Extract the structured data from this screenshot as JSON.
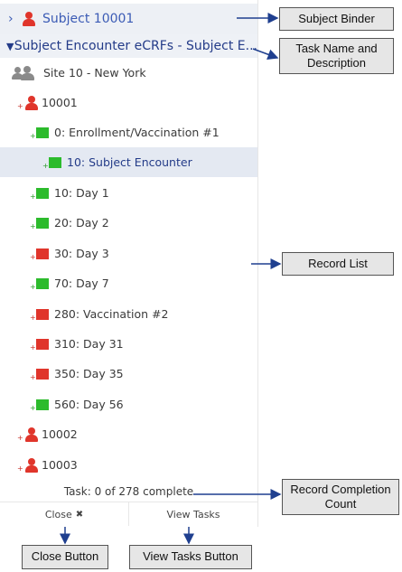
{
  "binder": {
    "label": "Subject 10001"
  },
  "task": {
    "label": "Subject Encounter eCRFs - Subject E..."
  },
  "site": {
    "label": "Site 10 - New York"
  },
  "records": [
    {
      "label": "10001",
      "type": "subject",
      "status": "red"
    },
    {
      "label": "0: Enrollment/Vaccination #1",
      "type": "form",
      "status": "green"
    },
    {
      "label": "10: Subject Encounter",
      "type": "form",
      "status": "green",
      "selected": true
    },
    {
      "label": "10: Day 1",
      "type": "form",
      "status": "green"
    },
    {
      "label": "20: Day 2",
      "type": "form",
      "status": "green"
    },
    {
      "label": "30: Day 3",
      "type": "form",
      "status": "red"
    },
    {
      "label": "70: Day 7",
      "type": "form",
      "status": "green"
    },
    {
      "label": "280: Vaccination #2",
      "type": "form",
      "status": "red"
    },
    {
      "label": "310: Day 31",
      "type": "form",
      "status": "red"
    },
    {
      "label": "350: Day 35",
      "type": "form",
      "status": "red"
    },
    {
      "label": "560: Day 56",
      "type": "form",
      "status": "green"
    },
    {
      "label": "10002",
      "type": "subject",
      "status": "red"
    },
    {
      "label": "10003",
      "type": "subject",
      "status": "red"
    }
  ],
  "footer": {
    "count": "Task: 0 of 278 complete",
    "close_label": "Close",
    "close_icon": "close-x-icon",
    "view_tasks_label": "View Tasks"
  },
  "callouts": {
    "binder": "Subject Binder",
    "task": "Task Name and Description",
    "record_list": "Record List",
    "completion": "Record Completion Count",
    "close": "Close Button",
    "view_tasks": "View Tasks Button"
  },
  "colors": {
    "red": "#e0352b",
    "green": "#2cbb2c",
    "accent": "#3b5bb5"
  }
}
